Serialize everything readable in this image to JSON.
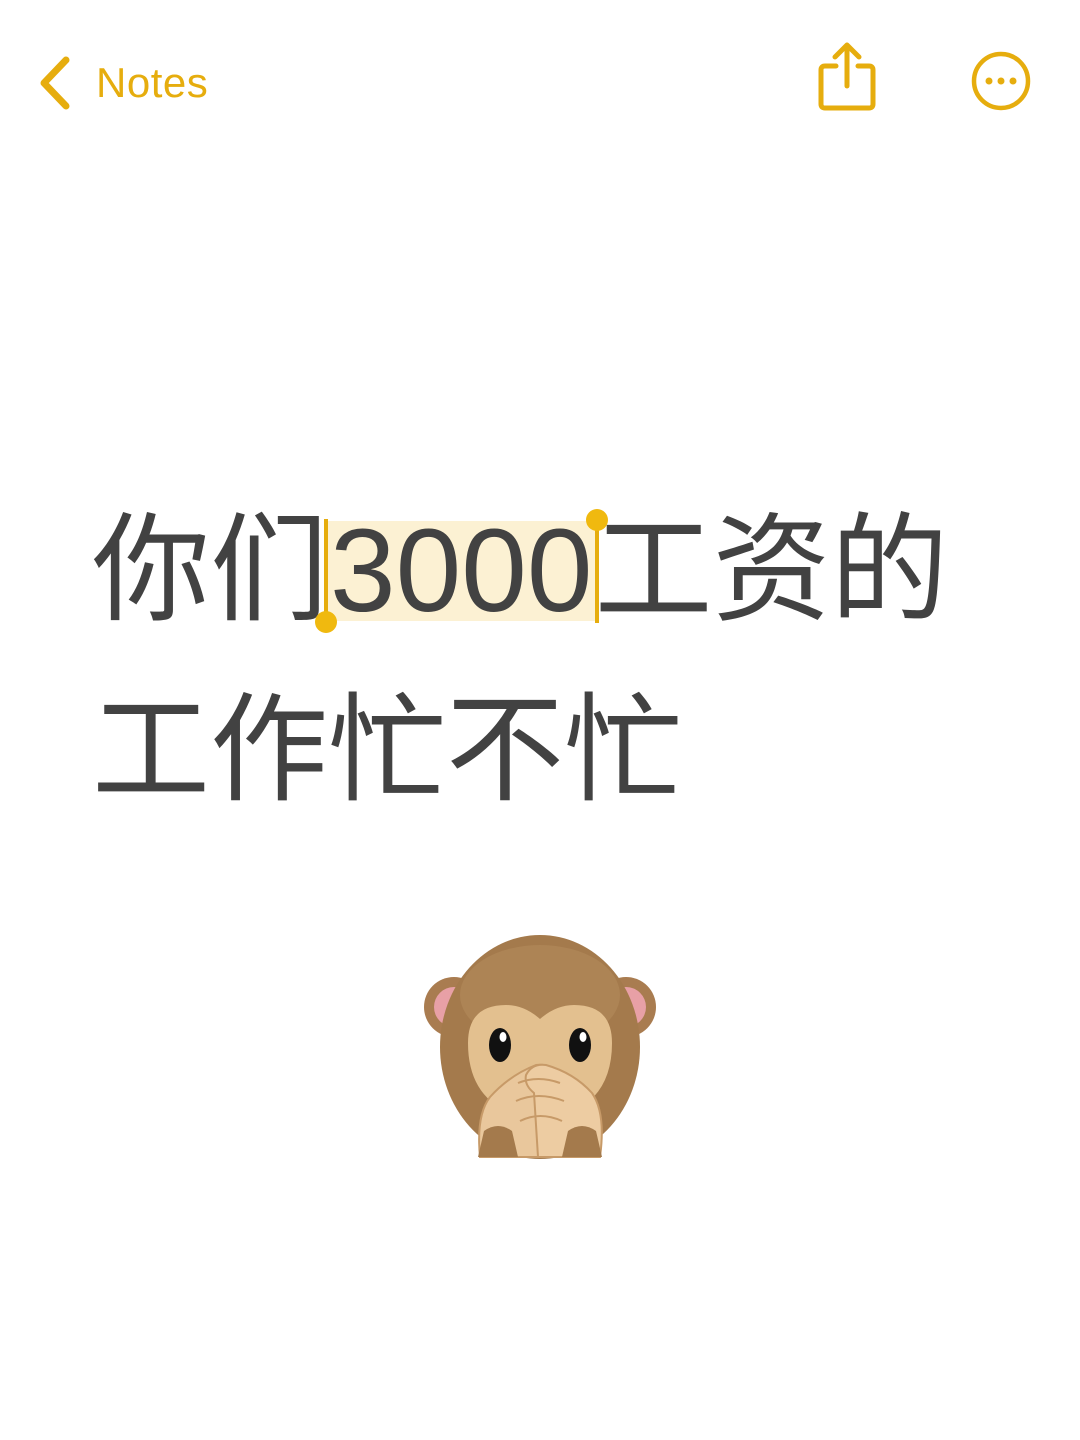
{
  "nav": {
    "back_label": "Notes",
    "accent_color": "#E6AD0E"
  },
  "note": {
    "line1_before": "你们",
    "line1_selected": "3000",
    "line1_after": "工资的",
    "line2": "工作忙不忙",
    "emoji": "see-no-evil / speak-no-evil monkey emoji (monkey covering mouth)"
  },
  "colors": {
    "text": "#424242",
    "selection_bg": "#FCF1D3",
    "selection_handle": "#F0B90F"
  }
}
